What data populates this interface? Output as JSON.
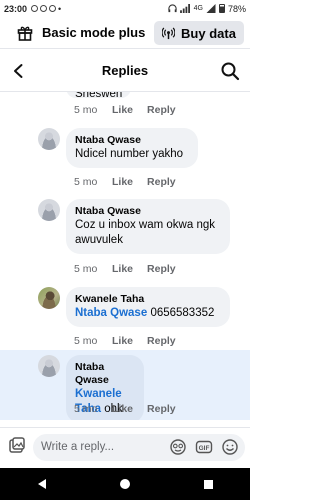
{
  "status_bar": {
    "time": "23:00",
    "battery": "78%"
  },
  "mode_bar": {
    "title": "Basic mode plus",
    "buy_data_label": "Buy data"
  },
  "header": {
    "title": "Replies"
  },
  "comments": [
    {
      "name": "",
      "text": "Sheswen",
      "time": "5 mo",
      "like": "Like",
      "reply": "Reply",
      "partial": true
    },
    {
      "name": "Ntaba Qwase",
      "text": "Ndicel number yakho",
      "time": "5 mo",
      "like": "Like",
      "reply": "Reply"
    },
    {
      "name": "Ntaba Qwase",
      "text": "Coz u inbox wam okwa ngk awuvulek",
      "time": "5 mo",
      "like": "Like",
      "reply": "Reply"
    },
    {
      "name": "Kwanele Taha",
      "mention": "Ntaba Qwase",
      "text": "0656583352",
      "time": "5 mo",
      "like": "Like",
      "reply": "Reply"
    },
    {
      "name": "Ntaba Qwase",
      "mention": "Kwanele Taha",
      "text": "ohk",
      "time": "5 mo",
      "like": "Like",
      "reply": "Reply",
      "highlighted": true
    }
  ],
  "composer": {
    "placeholder": "Write a reply..."
  },
  "icons": {
    "back": "arrow-left-icon",
    "search": "search-icon",
    "gift": "gift-icon",
    "buy_data": "broadcast-icon",
    "photo": "photo-icon",
    "sticker": "sticker-icon",
    "gif": "gif-icon",
    "emoji": "emoji-icon"
  },
  "colors": {
    "mention": "#1b6fd1",
    "highlight": "#e7f0fc"
  }
}
